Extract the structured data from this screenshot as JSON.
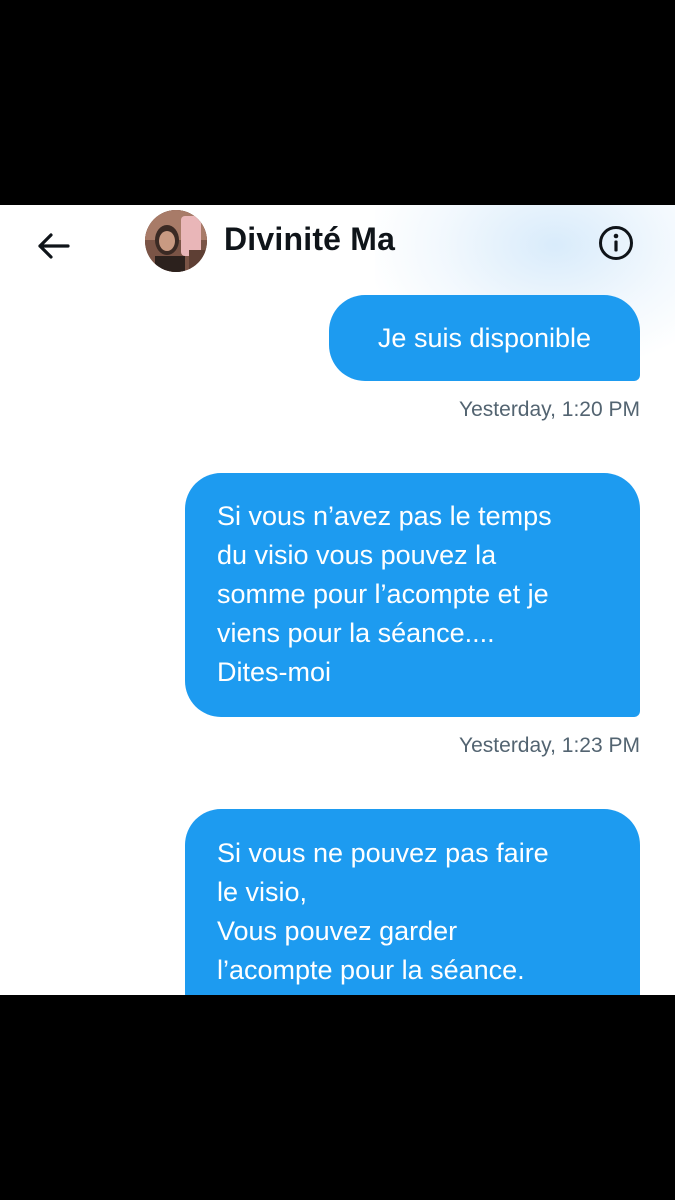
{
  "header": {
    "back_icon": "arrow-left-icon",
    "contact_name": "Divinité Ma",
    "info_icon": "info-icon"
  },
  "messages": [
    {
      "text": "Je suis disponible",
      "timestamp": "Yesterday, 1:20 PM"
    },
    {
      "text": "Si vous n’avez pas le temps\ndu visio vous pouvez la\nsomme pour l’acompte et je\nviens pour la séance....\nDites-moi",
      "timestamp": "Yesterday, 1:23 PM"
    },
    {
      "text": "Si vous ne pouvez pas faire\nle visio,\nVous pouvez garder\nl’acompte pour la séance."
    }
  ],
  "colors": {
    "bubble": "#1d9bf0",
    "timestamp": "#536471",
    "name": "#0f1419",
    "letterbox": "#000000"
  }
}
